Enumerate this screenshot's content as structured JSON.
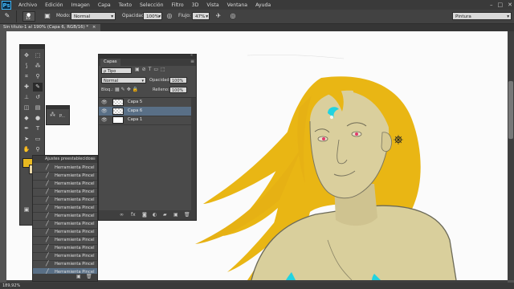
{
  "app": {
    "logo": "Ps"
  },
  "menu": [
    "Archivo",
    "Edición",
    "Imagen",
    "Capa",
    "Texto",
    "Selección",
    "Filtro",
    "3D",
    "Vista",
    "Ventana",
    "Ayuda"
  ],
  "window_controls": {
    "minimize": "–",
    "restore": "□",
    "close": "✕"
  },
  "options": {
    "brush_size": "15",
    "mode_label": "Modo:",
    "mode_value": "Normal",
    "opacity_label": "Opacidad:",
    "opacity_value": "100%",
    "flow_label": "Flujo:",
    "flow_value": "47%",
    "workspace": "Pintura"
  },
  "document": {
    "tab": "Sin título-1 al 190% (Capa 6, RGB/16) *"
  },
  "status": {
    "zoom": "189,92%"
  },
  "presets_panel": {
    "title": "Ajustes preestablecidos",
    "items": [
      "Herramienta Pincel",
      "Herramienta Pincel",
      "Herramienta Pincel",
      "Herramienta Pincel",
      "Herramienta Pincel",
      "Herramienta Pincel",
      "Herramienta Pincel",
      "Herramienta Pincel",
      "Herramienta Pincel",
      "Herramienta Pincel",
      "Herramienta Pincel",
      "Herramienta Pincel",
      "Herramienta Pincel",
      "Herramienta Pincel"
    ],
    "selected_index": 13
  },
  "mini_panel": {
    "label": "P..."
  },
  "layers_panel": {
    "tab": "Capas",
    "filter_kind": "Tipo",
    "blend_mode": "Normal",
    "opacity_label": "Opacidad:",
    "opacity_value": "100%",
    "lock_label": "Bloq.:",
    "fill_label": "Relleno:",
    "fill_value": "100%",
    "layers": [
      {
        "name": "Capa 5",
        "selected": false
      },
      {
        "name": "Capa 6",
        "selected": true
      },
      {
        "name": "Capa 1",
        "selected": false
      }
    ]
  },
  "colors": {
    "foreground": "#e8b820",
    "background": "#ead8a8",
    "hair": "#e9b614",
    "skin": "#d9cf9c",
    "accent_cyan": "#22d3e0",
    "eye_pink": "#e23a6a",
    "selected_layer": "#596f86"
  }
}
